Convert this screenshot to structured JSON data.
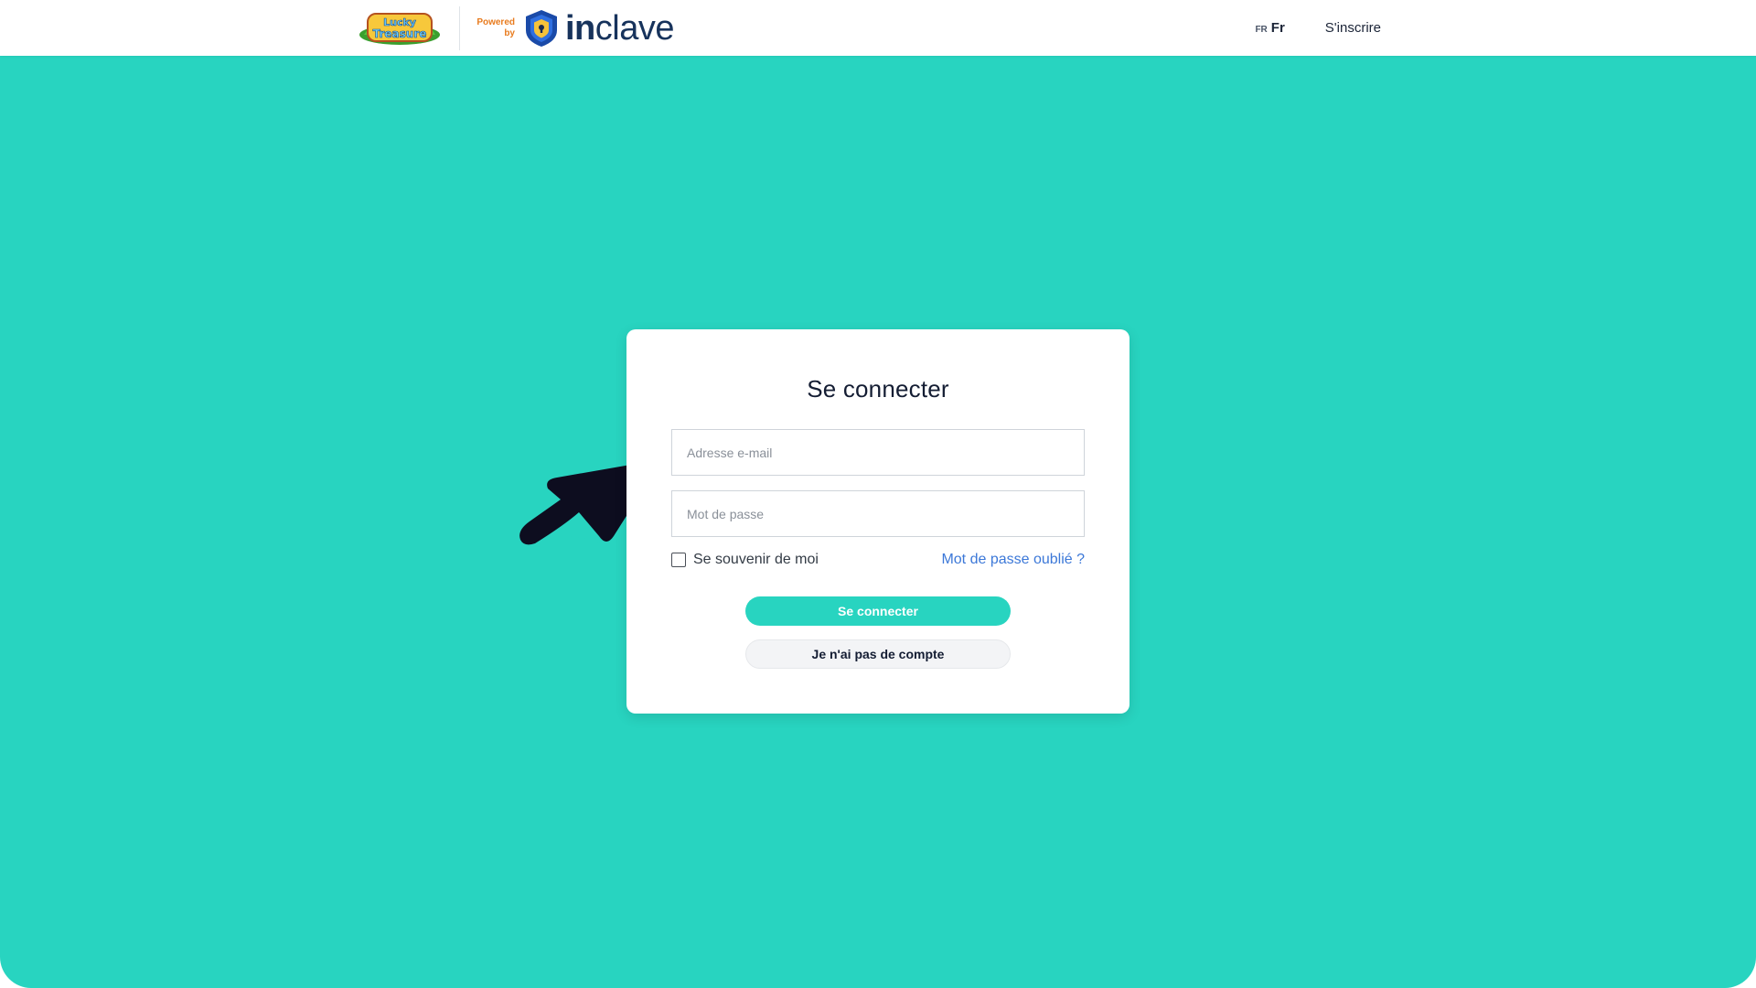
{
  "header": {
    "logo_name": "Lucky Treasure",
    "logo_line1": "Lucky",
    "logo_line2": "Treasure",
    "powered_line1": "Powered",
    "powered_line2": "by",
    "brand_prefix": "in",
    "brand_suffix": "clave",
    "lang_code": "FR",
    "lang_name": "Fr",
    "signup_label": "S'inscrire"
  },
  "login": {
    "title": "Se connecter",
    "email_placeholder": "Adresse e-mail",
    "password_placeholder": "Mot de passe",
    "remember_label": "Se souvenir de moi",
    "forgot_label": "Mot de passe oublié ?",
    "submit_label": "Se connecter",
    "no_account_label": "Je n'ai pas de compte"
  },
  "colors": {
    "accent": "#28d4c0",
    "link": "#3c78d8",
    "brand_navy": "#17335c",
    "powered_orange": "#e87b1e",
    "cursor": "#0d0d1f"
  },
  "icons": {
    "lucky_treasure_logo": "lucky-treasure-logo-icon",
    "inclave_shield": "inclave-shield-icon",
    "remember_checkbox": "checkbox-icon",
    "pointer_arrow": "cursor-arrow-icon"
  }
}
